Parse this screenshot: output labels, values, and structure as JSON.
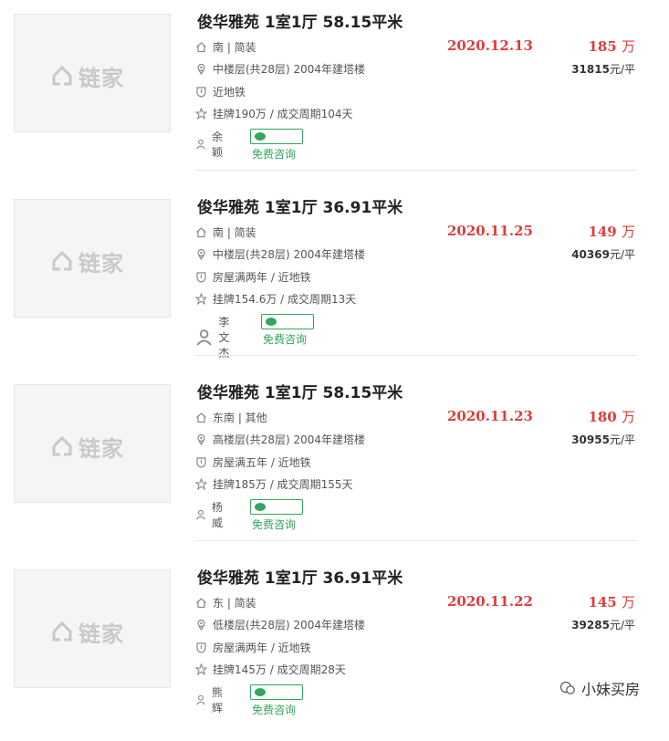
{
  "brand_logo_text": "链家",
  "listings": [
    {
      "title": "俊华雅苑 1室1厅 58.15平米",
      "orientation": "南 | 简装",
      "floor": "中楼层(共28层) 2004年建塔楼",
      "tags": "近地铁",
      "listing_info": "挂牌190万 / 成交周期104天",
      "agent": "余颖",
      "consult_label": "免费咨询",
      "date": "2020.12.13",
      "price": "185",
      "price_unit": "万",
      "unit_price": "31815",
      "unit_price_suffix": "元/平"
    },
    {
      "title": "俊华雅苑 1室1厅 36.91平米",
      "orientation": "南 | 简装",
      "floor": "中楼层(共28层) 2004年建塔楼",
      "tags": "房屋满两年 / 近地铁",
      "listing_info": "挂牌154.6万 / 成交周期13天",
      "agent": "李文杰",
      "consult_label": "免费咨询",
      "date": "2020.11.25",
      "price": "149",
      "price_unit": "万",
      "unit_price": "40369",
      "unit_price_suffix": "元/平"
    },
    {
      "title": "俊华雅苑 1室1厅 58.15平米",
      "orientation": "东南 | 其他",
      "floor": "高楼层(共28层) 2004年建塔楼",
      "tags": "房屋满五年 / 近地铁",
      "listing_info": "挂牌185万 / 成交周期155天",
      "agent": "杨威",
      "consult_label": "免费咨询",
      "date": "2020.11.23",
      "price": "180",
      "price_unit": "万",
      "unit_price": "30955",
      "unit_price_suffix": "元/平"
    },
    {
      "title": "俊华雅苑 1室1厅 36.91平米",
      "orientation": "东 | 简装",
      "floor": "低楼层(共28层) 2004年建塔楼",
      "tags": "房屋满两年 / 近地铁",
      "listing_info": "挂牌145万 / 成交周期28天",
      "agent": "熊辉",
      "consult_label": "免费咨询",
      "date": "2020.11.22",
      "price": "145",
      "price_unit": "万",
      "unit_price": "39285",
      "unit_price_suffix": "元/平"
    }
  ],
  "watermark": "小妹买房",
  "colors": {
    "accent_red": "#e03c3c",
    "wechat_green": "#33a55c",
    "logo_gray": "#c9c9c9"
  },
  "icons": [
    "house-icon",
    "location-icon",
    "shield-icon",
    "star-icon",
    "person-icon",
    "wechat-icon"
  ]
}
